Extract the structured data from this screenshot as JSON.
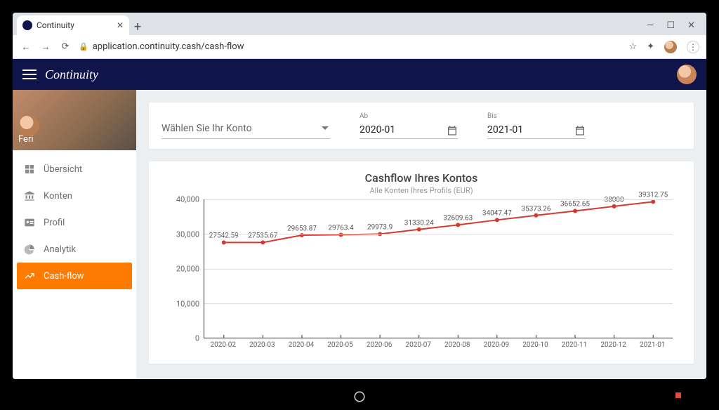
{
  "browser": {
    "tab_title": "Continuity",
    "url": "application.continuity.cash/cash-flow"
  },
  "header": {
    "brand": "Continuity"
  },
  "sidebar": {
    "profile_name": "Feri",
    "items": [
      {
        "label": "Übersicht",
        "icon": "dashboard-icon"
      },
      {
        "label": "Konten",
        "icon": "bank-icon"
      },
      {
        "label": "Profil",
        "icon": "id-icon"
      },
      {
        "label": "Analytik",
        "icon": "piechart-icon"
      },
      {
        "label": "Cash-flow",
        "icon": "trend-icon"
      }
    ]
  },
  "filters": {
    "account_placeholder": "Wählen Sie Ihr Konto",
    "from_label": "Ab",
    "from_value": "2020-01",
    "to_label": "Bis",
    "to_value": "2021-01"
  },
  "chart_meta": {
    "title": "Cashflow Ihres Kontos",
    "subtitle": "Alle Konten Ihres Profils (EUR)"
  },
  "chart_data": {
    "type": "line",
    "title": "Cashflow Ihres Kontos",
    "subtitle": "Alle Konten Ihres Profils (EUR)",
    "xlabel": "",
    "ylabel": "",
    "ylim": [
      0,
      40000
    ],
    "yticks": [
      0,
      10000,
      20000,
      30000,
      40000
    ],
    "ytick_labels": [
      "0",
      "10,000",
      "20,000",
      "30,000",
      "40,000"
    ],
    "categories": [
      "2020-02",
      "2020-03",
      "2020-04",
      "2020-05",
      "2020-06",
      "2020-07",
      "2020-08",
      "2020-09",
      "2020-10",
      "2020-11",
      "2020-12",
      "2021-01"
    ],
    "series": [
      {
        "name": "Cashflow",
        "color": "#d33a2f",
        "values": [
          27542.59,
          27535.67,
          29653.87,
          29763.4,
          29973.9,
          31330.24,
          32609.63,
          34047.47,
          35373.26,
          36652.65,
          38000,
          39312.75
        ]
      }
    ]
  }
}
